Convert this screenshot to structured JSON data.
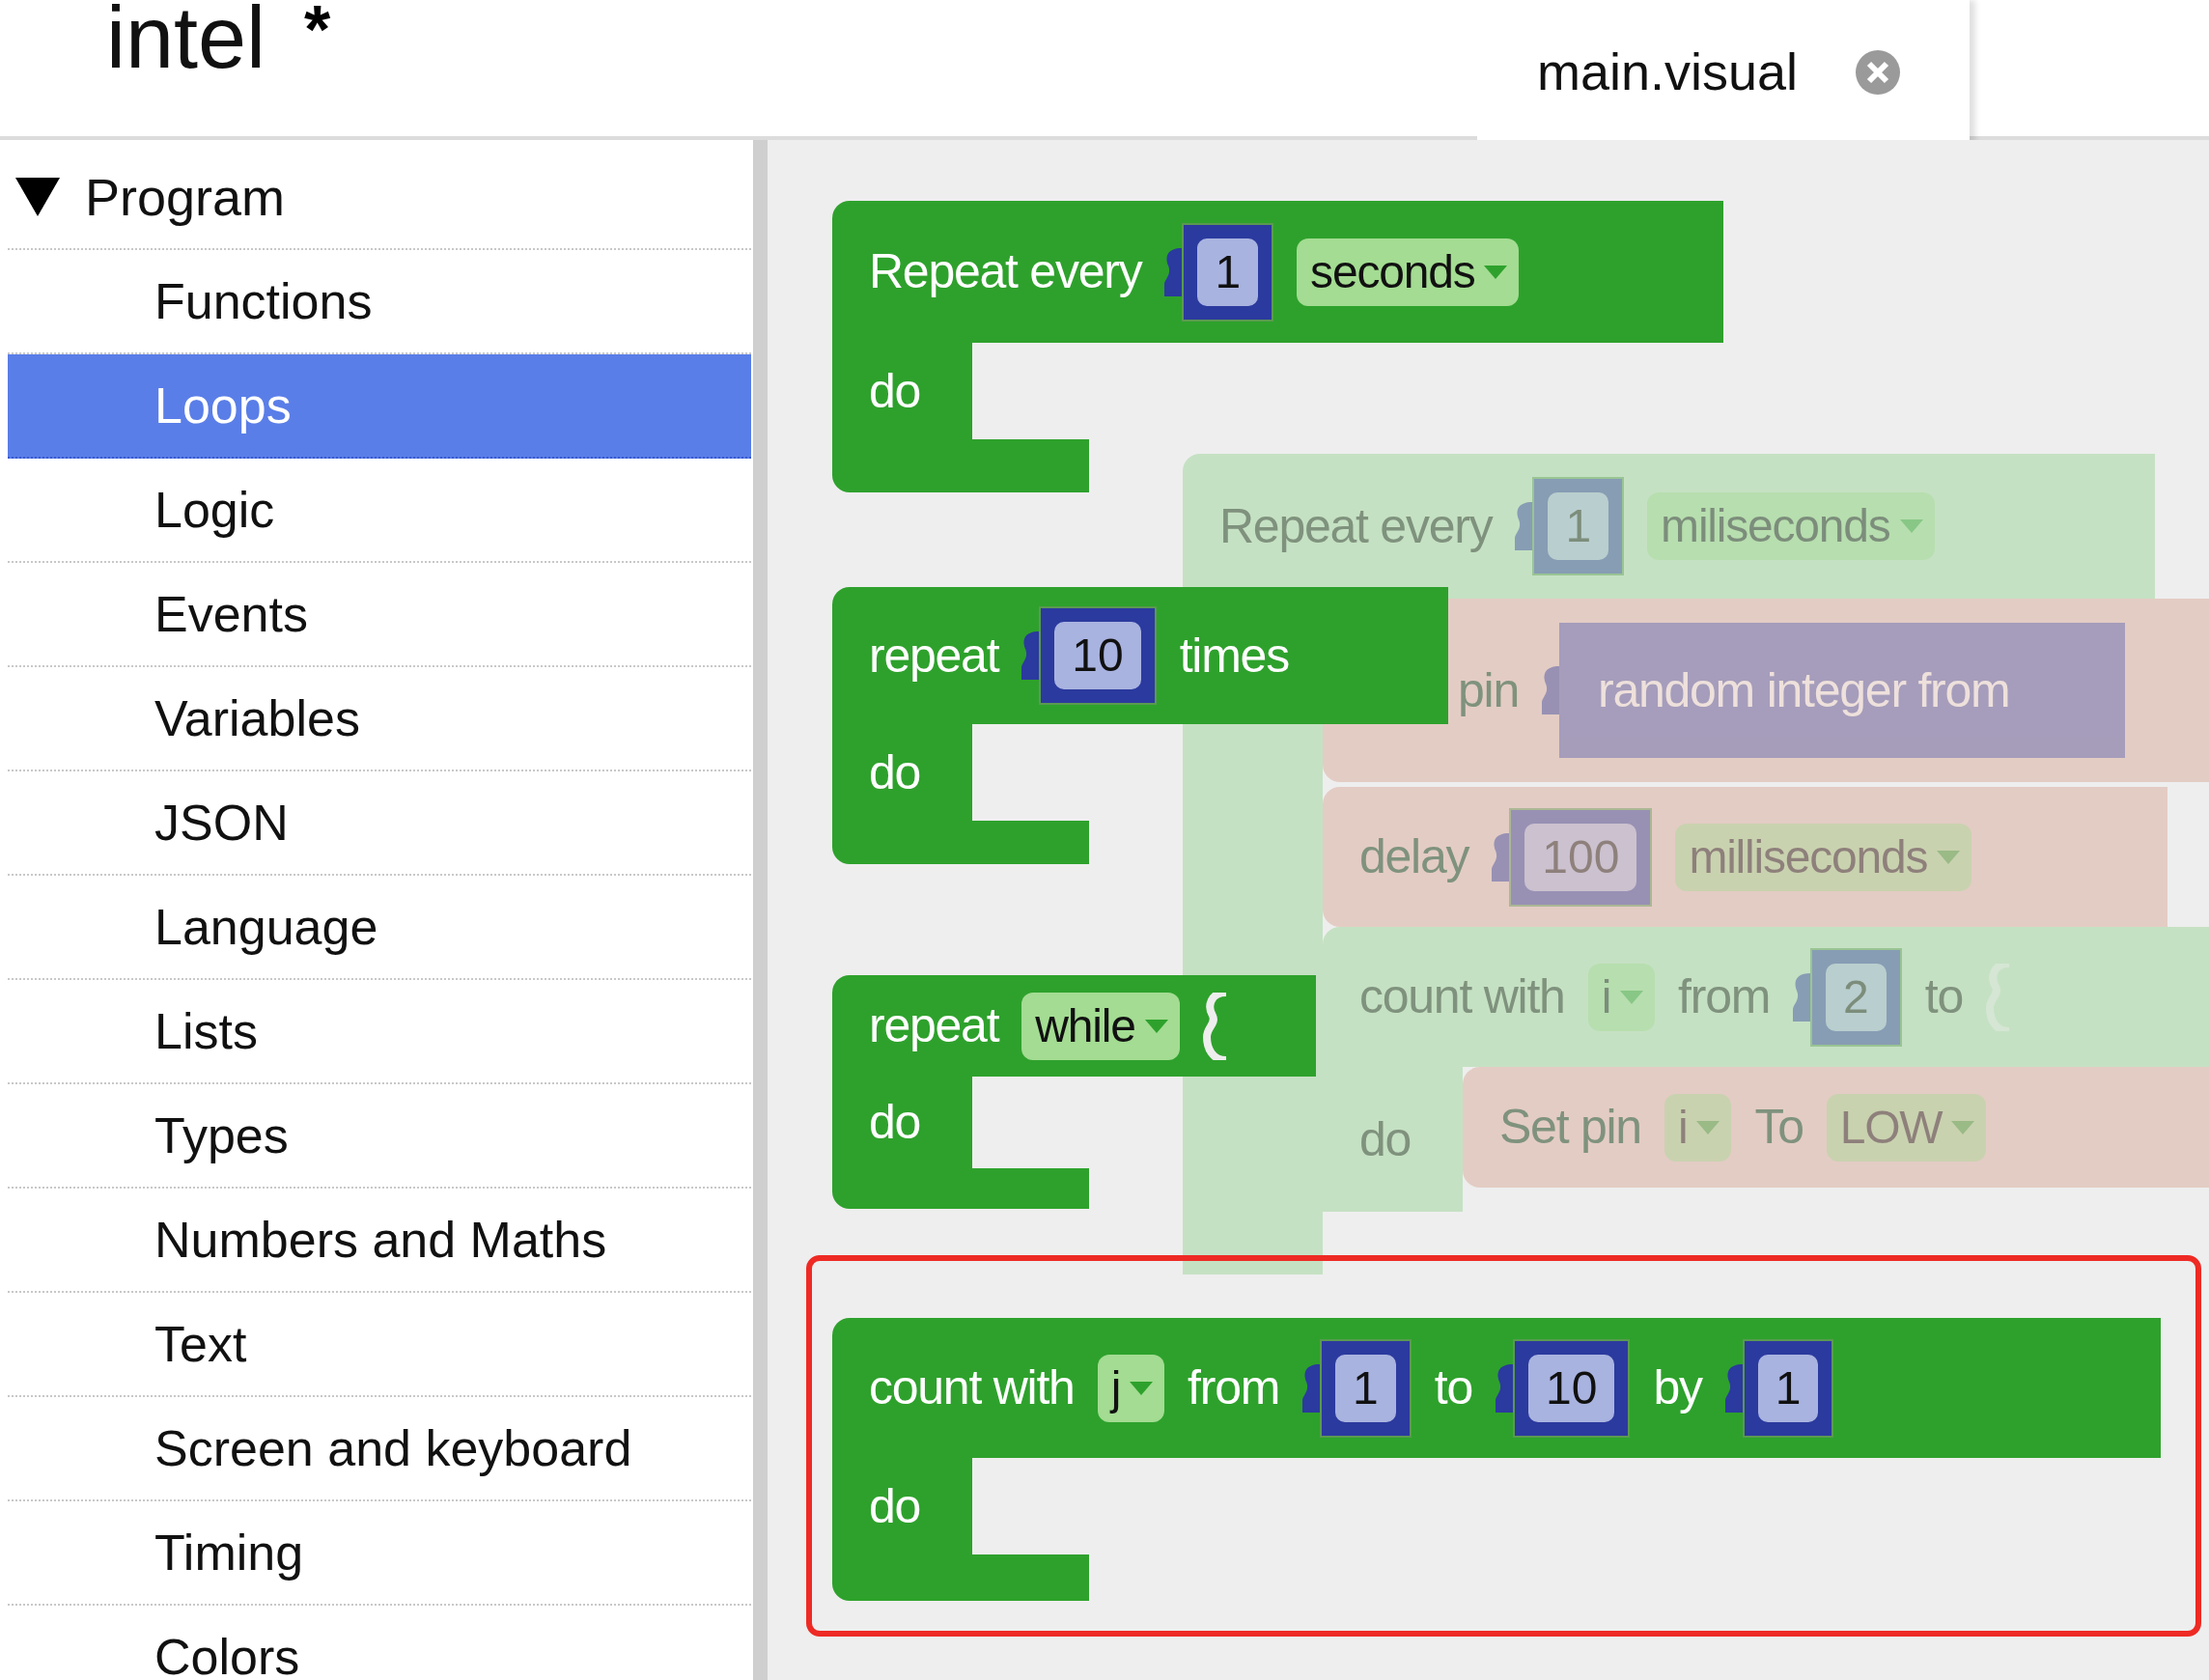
{
  "header": {
    "title": "intel",
    "mark": "*"
  },
  "tabs": [
    {
      "label": "main.visual",
      "selected": true
    }
  ],
  "sidebar": {
    "items": [
      {
        "label": "Program",
        "expanded": true,
        "selected": false,
        "children": [
          {
            "label": "Functions",
            "selected": false
          },
          {
            "label": "Loops",
            "selected": true
          },
          {
            "label": "Logic",
            "selected": false
          },
          {
            "label": "Events",
            "selected": false
          },
          {
            "label": "Variables",
            "selected": false
          },
          {
            "label": "JSON",
            "selected": false
          },
          {
            "label": "Language",
            "selected": false
          },
          {
            "label": "Lists",
            "selected": false
          },
          {
            "label": "Types",
            "selected": false
          },
          {
            "label": "Numbers and Maths",
            "selected": false
          },
          {
            "label": "Text",
            "selected": false
          },
          {
            "label": "Screen and keyboard",
            "selected": false
          },
          {
            "label": "Timing",
            "selected": false
          },
          {
            "label": "Colors",
            "selected": false
          }
        ]
      }
    ]
  },
  "workspace": {
    "blocks": [
      {
        "kind": "loop",
        "faded": false,
        "highlighted": false,
        "color": "#2ea12c",
        "do": "do",
        "fields": [
          {
            "kind": "label",
            "text": "Repeat every"
          },
          {
            "kind": "number",
            "text": "1"
          },
          {
            "kind": "dropdown",
            "text": "seconds"
          }
        ]
      },
      {
        "kind": "loop",
        "faded": true,
        "highlighted": false,
        "color": "#c5e1c3",
        "fields": [
          {
            "kind": "label",
            "text": "Repeat every"
          },
          {
            "kind": "number",
            "text": "1"
          },
          {
            "kind": "dropdown",
            "text": "miliseconds"
          }
        ]
      },
      {
        "kind": "loop",
        "faded": false,
        "highlighted": false,
        "color": "#2ea12c",
        "do": "do",
        "fields": [
          {
            "kind": "label",
            "text": "repeat"
          },
          {
            "kind": "number",
            "text": "10"
          },
          {
            "kind": "label",
            "text": "times"
          }
        ]
      },
      {
        "kind": "statement",
        "faded": true,
        "highlighted": false,
        "color": "#e3ccc4",
        "fields": [
          {
            "kind": "label",
            "text": "pin"
          },
          {
            "kind": "value",
            "text": "random integer from"
          }
        ]
      },
      {
        "kind": "statement",
        "faded": true,
        "highlighted": false,
        "color": "#e3ccc4",
        "fields": [
          {
            "kind": "label",
            "text": "delay"
          },
          {
            "kind": "number",
            "text": "100"
          },
          {
            "kind": "dropdown",
            "text": "milliseconds"
          }
        ]
      },
      {
        "kind": "loop",
        "faded": false,
        "highlighted": false,
        "color": "#2ea12c",
        "do": "do",
        "fields": [
          {
            "kind": "label",
            "text": "repeat"
          },
          {
            "kind": "dropdown",
            "text": "while"
          },
          {
            "kind": "socket"
          }
        ]
      },
      {
        "kind": "loop",
        "faded": true,
        "highlighted": false,
        "color": "#c5e1c3",
        "do": "do",
        "fields": [
          {
            "kind": "label",
            "text": "count with"
          },
          {
            "kind": "dropdown",
            "text": "i"
          },
          {
            "kind": "label",
            "text": "from"
          },
          {
            "kind": "number",
            "text": "2"
          },
          {
            "kind": "label",
            "text": "to"
          },
          {
            "kind": "socket"
          }
        ]
      },
      {
        "kind": "statement",
        "faded": true,
        "highlighted": false,
        "color": "#e3ccc4",
        "fields": [
          {
            "kind": "label",
            "text": "Set pin"
          },
          {
            "kind": "dropdown",
            "text": "i"
          },
          {
            "kind": "label",
            "text": "To"
          },
          {
            "kind": "dropdown",
            "text": "LOW"
          }
        ]
      },
      {
        "kind": "loop",
        "faded": false,
        "highlighted": true,
        "color": "#2ea12c",
        "do": "do",
        "fields": [
          {
            "kind": "label",
            "text": "count with"
          },
          {
            "kind": "dropdown",
            "text": "j"
          },
          {
            "kind": "label",
            "text": "from"
          },
          {
            "kind": "number",
            "text": "1"
          },
          {
            "kind": "label",
            "text": "to"
          },
          {
            "kind": "number",
            "text": "10"
          },
          {
            "kind": "label",
            "text": "by"
          },
          {
            "kind": "number",
            "text": "1"
          }
        ]
      }
    ]
  }
}
